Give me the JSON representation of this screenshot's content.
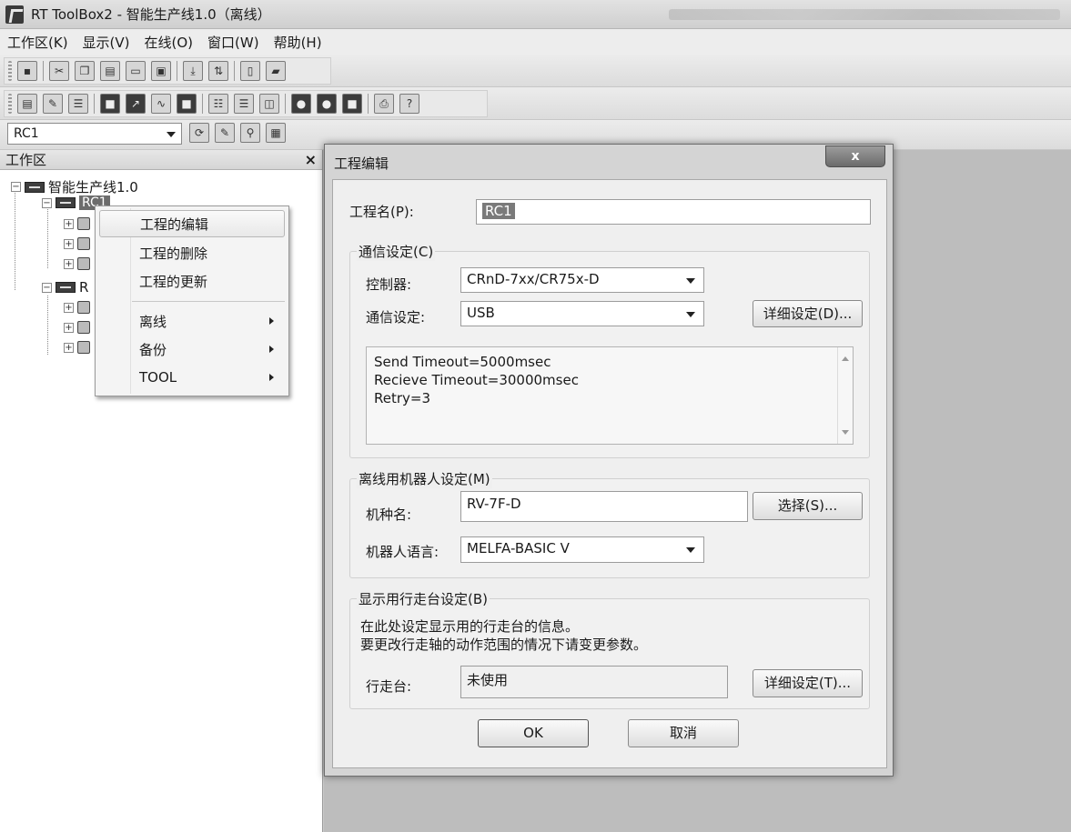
{
  "window": {
    "title": "RT ToolBox2 - 智能生产线1.0（离线）"
  },
  "menu": [
    "工作区(K)",
    "显示(V)",
    "在线(O)",
    "窗口(W)",
    "帮助(H)"
  ],
  "robot_selector": {
    "value": "RC1"
  },
  "workspace": {
    "title": "工作区",
    "close": "×",
    "root": "智能生产线1.0",
    "project1": "RC1",
    "project2": "R"
  },
  "context_menu": {
    "items": [
      {
        "label": "工程的编辑",
        "submenu": false
      },
      {
        "label": "工程的删除",
        "submenu": false
      },
      {
        "label": "工程的更新",
        "submenu": false
      },
      {
        "label": "离线",
        "submenu": true
      },
      {
        "label": "备份",
        "submenu": true
      },
      {
        "label": "TOOL",
        "submenu": true
      }
    ]
  },
  "dialog": {
    "title": "工程编辑",
    "close": "x",
    "project_name_label": "工程名(P):",
    "project_name_value": "RC1",
    "comm_group_title": "通信设定(C)",
    "controller_label": "控制器:",
    "controller_value": "CRnD-7xx/CR75x-D",
    "comm_label": "通信设定:",
    "comm_value": "USB",
    "comm_detail_button": "详细设定(D)...",
    "comm_info": [
      "Send Timeout=5000msec",
      "Recieve Timeout=30000msec",
      "Retry=3"
    ],
    "offline_group_title": "离线用机器人设定(M)",
    "model_label": "机种名:",
    "model_value": "RV-7F-D",
    "select_button": "选择(S)...",
    "language_label": "机器人语言:",
    "language_value": "MELFA-BASIC V",
    "track_group_title": "显示用行走台设定(B)",
    "track_desc_1": "在此处设定显示用的行走台的信息。",
    "track_desc_2": "要更改行走轴的动作范围的情况下请变更参数。",
    "track_label": "行走台:",
    "track_value": "未使用",
    "track_detail_button": "详细设定(T)...",
    "ok_button": "OK",
    "cancel_button": "取消"
  }
}
